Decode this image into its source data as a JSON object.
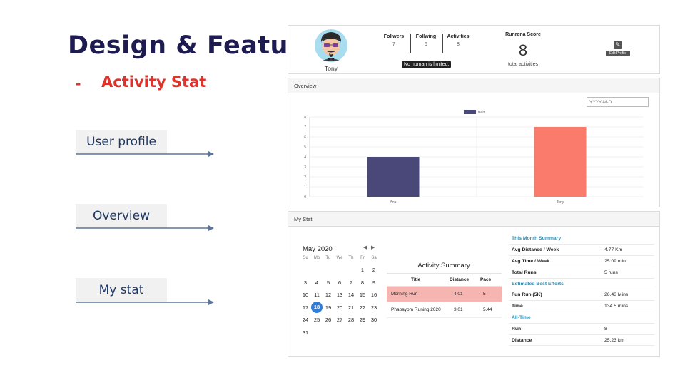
{
  "slide": {
    "title": "Design & Feature",
    "subtitle_marker": "-",
    "subtitle": "Activity Stat",
    "labels": [
      "User profile",
      "Overview",
      "My stat"
    ]
  },
  "profile": {
    "name": "Tony",
    "followers_label": "Follwers",
    "followers": "7",
    "following_label": "Follwing",
    "following": "5",
    "activities_label": "Activities",
    "activities": "8",
    "limit_badge": "No human is limited.",
    "score_title": "Runrena Score",
    "score": "8",
    "score_caption": "total activities",
    "edit_icon": "pencil-icon",
    "edit_label": "Edit Profile"
  },
  "overview": {
    "header": "Overview",
    "date_placeholder": "YYYY-M-D"
  },
  "chart_data": {
    "type": "bar",
    "categories": [
      "Anu",
      "Tony"
    ],
    "values": [
      4,
      7
    ],
    "colors": [
      "#4a4878",
      "#fa7b6b"
    ],
    "legend": [
      "Beat"
    ],
    "legend_position": "top",
    "ylim": [
      0,
      8
    ],
    "yticks": [
      "0",
      "1",
      "2",
      "3",
      "4",
      "5",
      "6",
      "7",
      "8"
    ],
    "grid": true,
    "title": "",
    "xlabel": "",
    "ylabel": ""
  },
  "mystat": {
    "header": "My Stat",
    "calendar": {
      "month": "May 2020",
      "prev": "◀",
      "next": "▶",
      "dow": [
        "Su",
        "Mo",
        "Tu",
        "We",
        "Th",
        "Fr",
        "Sa"
      ],
      "days": [
        "",
        "",
        "",
        "",
        "",
        "1",
        "2",
        "3",
        "4",
        "5",
        "6",
        "7",
        "8",
        "9",
        "10",
        "11",
        "12",
        "13",
        "14",
        "15",
        "16",
        "17",
        "18",
        "19",
        "20",
        "21",
        "22",
        "23",
        "24",
        "25",
        "26",
        "27",
        "28",
        "29",
        "30",
        "31"
      ],
      "selected": "18"
    },
    "summary": {
      "title": "Activity Summary",
      "columns": [
        "Title",
        "Distance",
        "Pace"
      ],
      "rows": [
        [
          "Morning Run",
          "4.01",
          "5"
        ],
        [
          "Phapayom Runing 2020",
          "3.01",
          "5.44"
        ]
      ]
    },
    "right": [
      {
        "section": "This Month Summary"
      },
      {
        "k": "Avg Distance / Week",
        "v": "4.77 Km"
      },
      {
        "k": "Avg Time / Week",
        "v": "25.09 min"
      },
      {
        "k": "Total Runs",
        "v": "5 runs"
      },
      {
        "section": "Estimated Best Efforts"
      },
      {
        "k": "Fun Run (5K)",
        "v": "26.43 Mins"
      },
      {
        "k": "Time",
        "v": "134.5 mins"
      },
      {
        "section": "All-Time"
      },
      {
        "k": "Run",
        "v": "8"
      },
      {
        "k": "Distance",
        "v": "25.23 km"
      }
    ]
  }
}
